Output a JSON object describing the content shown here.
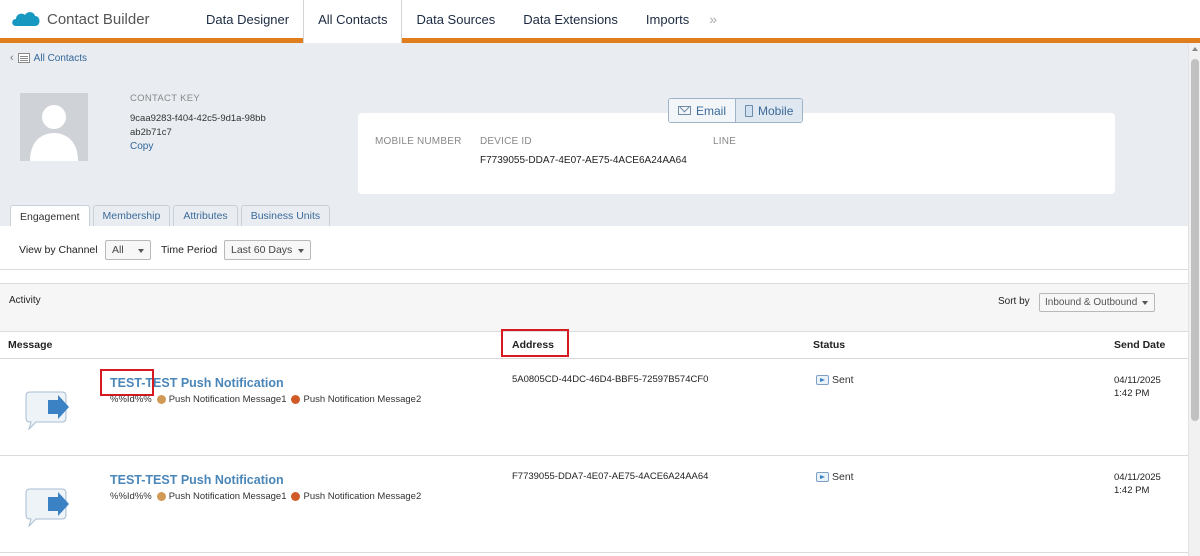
{
  "app": {
    "title": "Contact Builder",
    "tabs": [
      {
        "label": "Data Designer"
      },
      {
        "label": "All Contacts"
      },
      {
        "label": "Data Sources"
      },
      {
        "label": "Data Extensions"
      },
      {
        "label": "Imports"
      }
    ],
    "more_label": "»",
    "accent_color": "#e07e1e"
  },
  "breadcrumb": {
    "back_label": "All Contacts"
  },
  "contact": {
    "key_label": "CONTACT KEY",
    "key_value": "9caa9283-f404-42c5-9d1a-98bbab2b71c7",
    "copy_label": "Copy"
  },
  "channel": {
    "email_label": "Email",
    "mobile_label": "Mobile",
    "selected": "Mobile",
    "columns": {
      "mobile_number": "MOBILE NUMBER",
      "device_id": "DEVICE ID",
      "line": "LINE"
    },
    "device_id_value": "F7739055-DDA7-4E07-AE75-4ACE6A24AA64"
  },
  "subtabs": [
    {
      "label": "Engagement"
    },
    {
      "label": "Membership"
    },
    {
      "label": "Attributes"
    },
    {
      "label": "Business Units"
    }
  ],
  "filters": {
    "view_by_label": "View by Channel",
    "view_by_value": "All",
    "period_label": "Time Period",
    "period_value": "Last 60 Days"
  },
  "activity": {
    "title": "Activity",
    "sort_label": "Sort by",
    "sort_value": "Inbound & Outbound",
    "columns": {
      "message": "Message",
      "address": "Address",
      "status": "Status",
      "send_date": "Send Date"
    },
    "rows": [
      {
        "title": "TEST-TEST Push Notification",
        "sub_prefix": "%%Id%%",
        "sub_msg1": "Push Notification Message1",
        "sub_msg2": "Push Notification Message2",
        "address": "5A0805CD-44DC-46D4-BBF5-72597B574CF0",
        "status": "Sent",
        "date": "04/11/2025",
        "time": "1:42 PM"
      },
      {
        "title": "TEST-TEST Push Notification",
        "sub_prefix": "%%Id%%",
        "sub_msg1": "Push Notification Message1",
        "sub_msg2": "Push Notification Message2",
        "address": "F7739055-DDA7-4E07-AE75-4ACE6A24AA64",
        "status": "Sent",
        "date": "04/11/2025",
        "time": "1:42 PM"
      }
    ]
  },
  "highlight_color": "#d71920"
}
